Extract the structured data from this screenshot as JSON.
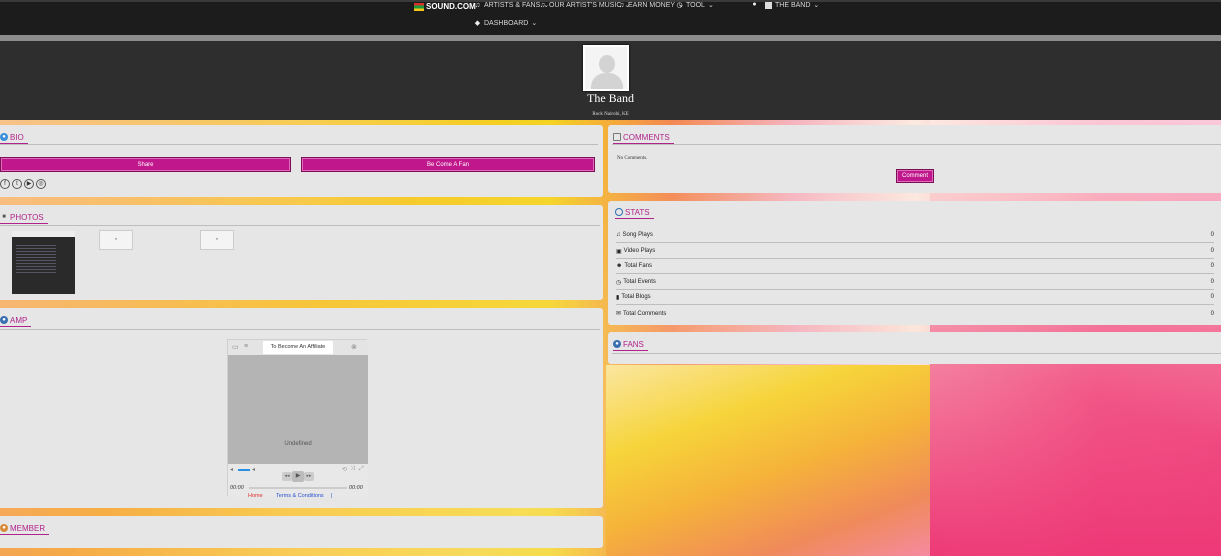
{
  "nav": {
    "logo": "SOUND.COM",
    "items": [
      "ARTISTS & FANS",
      "OUR ARTIST'S MUSIC",
      "EARN MONEY",
      "TOOL",
      "THE BAND"
    ],
    "dashboard": "DASHBOARD"
  },
  "profile": {
    "name": "The Band",
    "location": "Rock Nairobi, KE"
  },
  "bio": {
    "title": "BIO",
    "share_label": "Share",
    "fan_label": "Be Come A Fan",
    "social_icons": [
      "facebook-icon",
      "twitter-icon",
      "youtube-icon",
      "instagram-icon"
    ]
  },
  "photos": {
    "title": "PHOTOS"
  },
  "amp": {
    "title": "AMP",
    "tab_label": "To Become An Affiliate",
    "status": "Undefined",
    "time_start": "00:00",
    "time_end": "00:00",
    "link_home": "Home",
    "link_terms": "Terms & Conditions",
    "link_sep": "|"
  },
  "member": {
    "title": "MEMBER"
  },
  "comments": {
    "title": "COMMENTS",
    "empty_text": "No Comments.",
    "button_label": "Comment"
  },
  "stats": {
    "title": "STATS",
    "rows": [
      {
        "label": "Song Plays",
        "value": "0",
        "icon": "music-icon"
      },
      {
        "label": "Video Plays",
        "value": "0",
        "icon": "video-icon"
      },
      {
        "label": "Total Fans",
        "value": "0",
        "icon": "users-icon"
      },
      {
        "label": "Total Events",
        "value": "0",
        "icon": "clock-icon"
      },
      {
        "label": "Total Blogs",
        "value": "0",
        "icon": "bookmark-icon"
      },
      {
        "label": "Total Comments",
        "value": "0",
        "icon": "comments-icon"
      }
    ]
  },
  "fans": {
    "title": "FANS"
  },
  "colors": {
    "accent": "#c0178c",
    "panel": "#e6e6e6",
    "header": "#2e2e2e"
  }
}
